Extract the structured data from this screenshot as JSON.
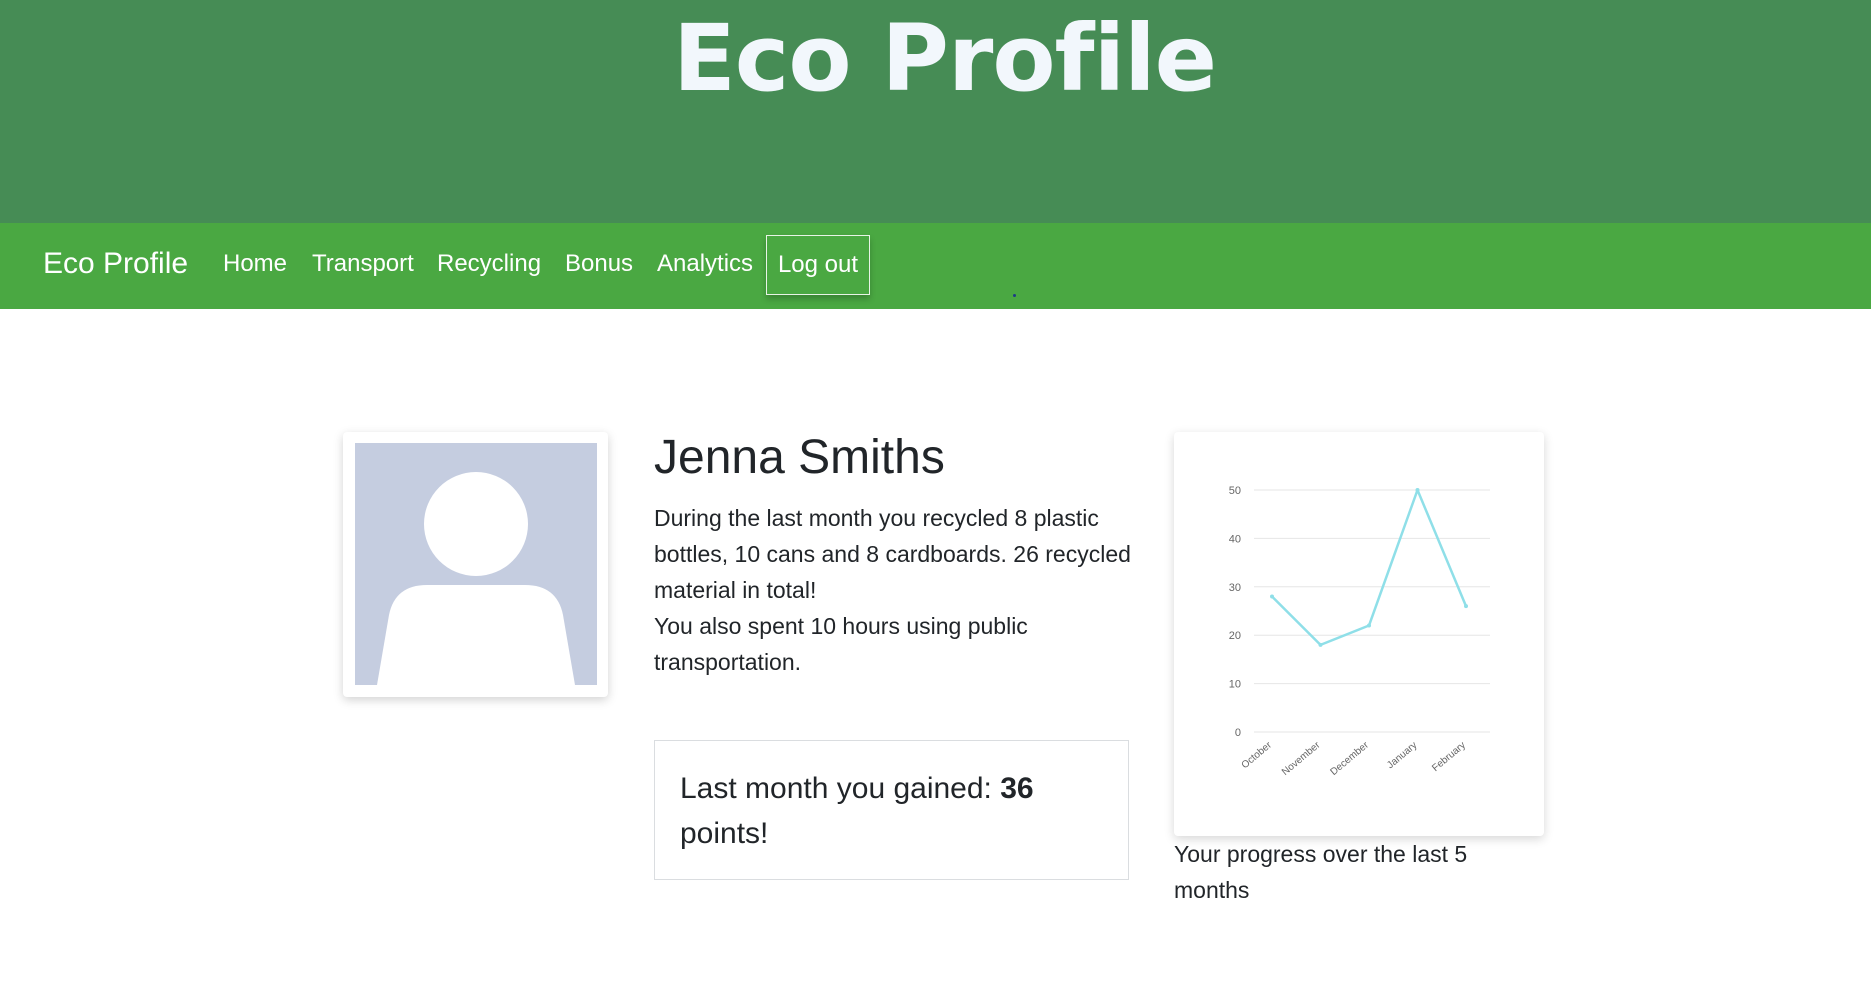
{
  "header": {
    "title": "Eco Profile"
  },
  "navbar": {
    "brand": "Eco Profile",
    "items": [
      "Home",
      "Transport",
      "Recycling",
      "Bonus",
      "Analytics"
    ],
    "logout_label": "Log out"
  },
  "profile": {
    "name": "Jenna Smiths",
    "summary_line1": "During the last month you recycled 8 plastic bottles, 10 cans and 8 cardboards. 26 recycled material in total!",
    "summary_line2": "You also spent 10 hours using public transportation.",
    "points_prefix": "Last month you gained: ",
    "points_value": "36",
    "points_suffix": " points!"
  },
  "chart_caption": "Your progress over the last 5 months",
  "colors": {
    "banner": "#468c55",
    "navbar": "#4aa842",
    "line": "#8fdfe8"
  },
  "chart_data": {
    "type": "line",
    "categories": [
      "October",
      "November",
      "December",
      "January",
      "February"
    ],
    "series": [
      {
        "values": [
          28,
          18,
          22,
          50,
          26
        ]
      }
    ],
    "ylim": [
      0,
      50
    ],
    "yticks": [
      0,
      10,
      20,
      30,
      40,
      50
    ],
    "grid": true,
    "legend": false
  }
}
